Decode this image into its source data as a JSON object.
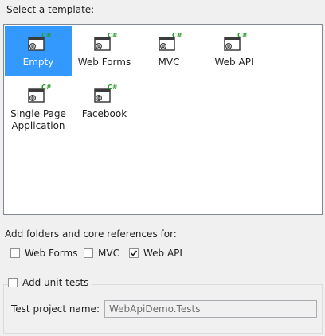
{
  "template_section": {
    "heading_prefix": "S",
    "heading_rest": "elect a template:",
    "templates": [
      {
        "label": "Empty",
        "selected": true,
        "icon": "csharp-web-project-icon"
      },
      {
        "label": "Web Forms",
        "selected": false,
        "icon": "csharp-web-project-icon"
      },
      {
        "label": "MVC",
        "selected": false,
        "icon": "csharp-web-project-icon"
      },
      {
        "label": "Web API",
        "selected": false,
        "icon": "csharp-web-project-icon"
      },
      {
        "label": "Single Page Application",
        "selected": false,
        "icon": "csharp-web-project-icon"
      },
      {
        "label": "Facebook",
        "selected": false,
        "icon": "csharp-web-project-icon"
      }
    ],
    "badge_text": "C#"
  },
  "references": {
    "label": "Add folders and core references for:",
    "options": [
      {
        "label": "Web Forms",
        "checked": false
      },
      {
        "label": "MVC",
        "checked": false
      },
      {
        "label": "Web API",
        "checked": true
      }
    ]
  },
  "unit_tests": {
    "label": "Add unit tests",
    "checked": false,
    "project_name_label": "Test project name:",
    "project_name_value": "WebApiDemo.Tests"
  },
  "colors": {
    "selection": "#3399ff",
    "badge_green": "#2e9b2e",
    "check_mark": "#1e1e1e"
  }
}
